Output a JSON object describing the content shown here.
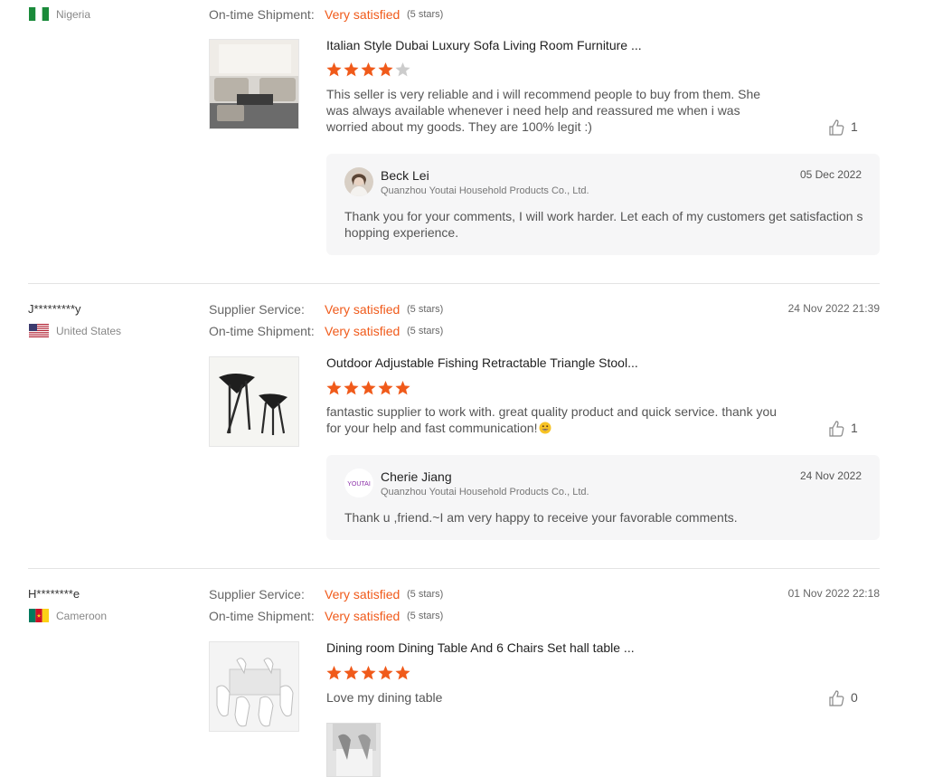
{
  "colors": {
    "accent": "#f05a1a",
    "star_empty": "#cccccc"
  },
  "reviews": [
    {
      "user": "",
      "country": "Nigeria",
      "flag": "nigeria-flag",
      "date": "",
      "metrics": [
        {
          "label": "On-time Shipment:",
          "value": "Very satisfied",
          "stars": "(5 stars)"
        }
      ],
      "product_title": "Italian Style Dubai Luxury Sofa Living Room Furniture ...",
      "product_image": "sofa-set-photo",
      "rating": 4,
      "comment": "This seller is very reliable and i will recommend people to buy from them. She was always available whenever i need help and reassured me when i was worried about my goods. They are 100% legit :)",
      "likes": "1",
      "reply": {
        "name": "Beck Lei",
        "company": "Quanzhou Youtai Household Products Co., Ltd.",
        "date": "05 Dec 2022",
        "text": "Thank you for your comments, I will work harder. Let each of my customers get satisfaction shopping experience."
      }
    },
    {
      "user": "J*********y",
      "country": "United States",
      "flag": "usa-flag",
      "date": "24 Nov 2022 21:39",
      "metrics": [
        {
          "label": "Supplier Service:",
          "value": "Very satisfied",
          "stars": "(5 stars)"
        },
        {
          "label": "On-time Shipment:",
          "value": "Very satisfied",
          "stars": "(5 stars)"
        }
      ],
      "product_title": "Outdoor Adjustable Fishing Retractable Triangle Stool...",
      "product_image": "tripod-stool-photo",
      "rating": 5,
      "comment": "fantastic supplier to work with. great quality product and quick service. thank you for your help and fast communication!",
      "likes": "1",
      "reply": {
        "name": "Cherie Jiang",
        "company": "Quanzhou Youtai Household Products Co., Ltd.",
        "date": "24 Nov 2022",
        "text": "Thank  u ,friend.~I am very happy to receive your favorable comments.",
        "avatar_text": "YOUTAI"
      }
    },
    {
      "user": "H********e",
      "country": "Cameroon",
      "flag": "cameroon-flag",
      "date": "01 Nov 2022 22:18",
      "metrics": [
        {
          "label": "Supplier Service:",
          "value": "Very satisfied",
          "stars": "(5 stars)"
        },
        {
          "label": "On-time Shipment:",
          "value": "Very satisfied",
          "stars": "(5 stars)"
        }
      ],
      "product_title": "Dining room Dining Table And 6 Chairs Set hall table ...",
      "product_image": "dining-set-photo",
      "rating": 5,
      "comment": "Love my dining table",
      "likes": "0"
    }
  ]
}
